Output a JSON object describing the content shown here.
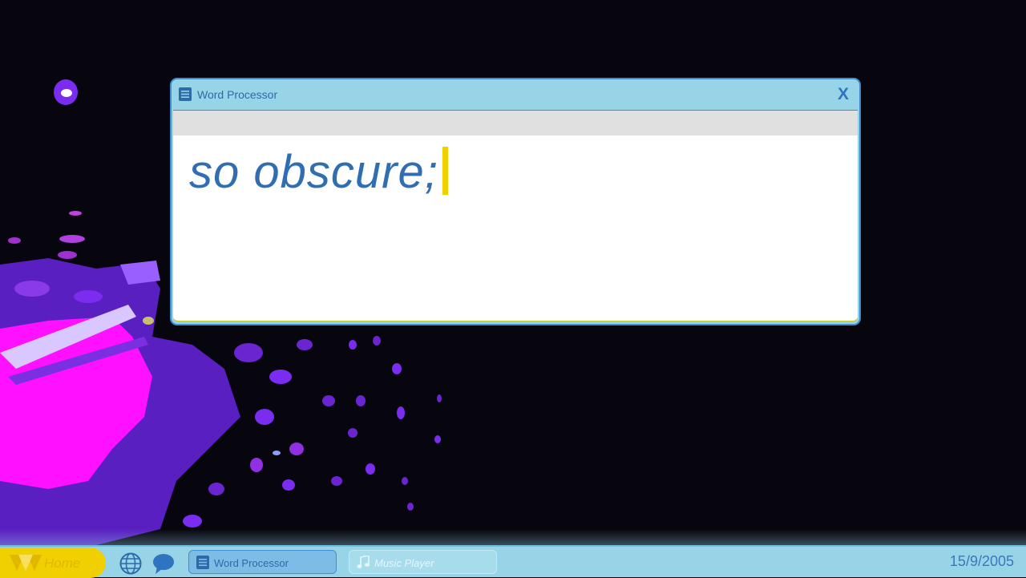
{
  "window": {
    "title": "Word Processor",
    "close_label": "X",
    "document_text": "so obscure;"
  },
  "taskbar": {
    "home_label": "Home",
    "tasks": [
      {
        "label": "Word Processor",
        "icon": "document-icon",
        "active": true
      },
      {
        "label": "Music Player",
        "icon": "music-note-icon",
        "active": false
      }
    ],
    "quick_launch": [
      "globe-icon",
      "chat-bubble-icon"
    ],
    "date": "15/9/2005"
  },
  "colors": {
    "window_frame": "#97d4e8",
    "accent_blue": "#2f6eb0",
    "caret_yellow": "#f0d000",
    "desktop_bg": "#07050d"
  }
}
